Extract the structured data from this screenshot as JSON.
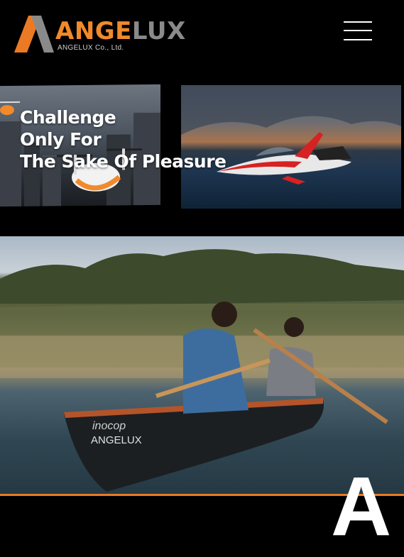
{
  "brand": {
    "name_part1": "ANGE",
    "name_part2": "LUX",
    "company": "ANGELUX Co., Ltd.",
    "colors": {
      "orange": "#ea7a24",
      "gray": "#8a8a8a",
      "background": "#000000"
    }
  },
  "header": {
    "menu_icon": "hamburger-icon"
  },
  "slider": {
    "headline": [
      "Challenge",
      "Only For",
      "The Sake Of Pleasure"
    ],
    "slides": [
      {
        "image": "flying-taxi-city-image"
      },
      {
        "image": "jet-boat-sea-image"
      }
    ]
  },
  "hero": {
    "image": "canoe-lake-couple-image",
    "boat_text": [
      "inocop",
      "ANGELUX"
    ]
  },
  "section": {
    "letter": "A"
  }
}
